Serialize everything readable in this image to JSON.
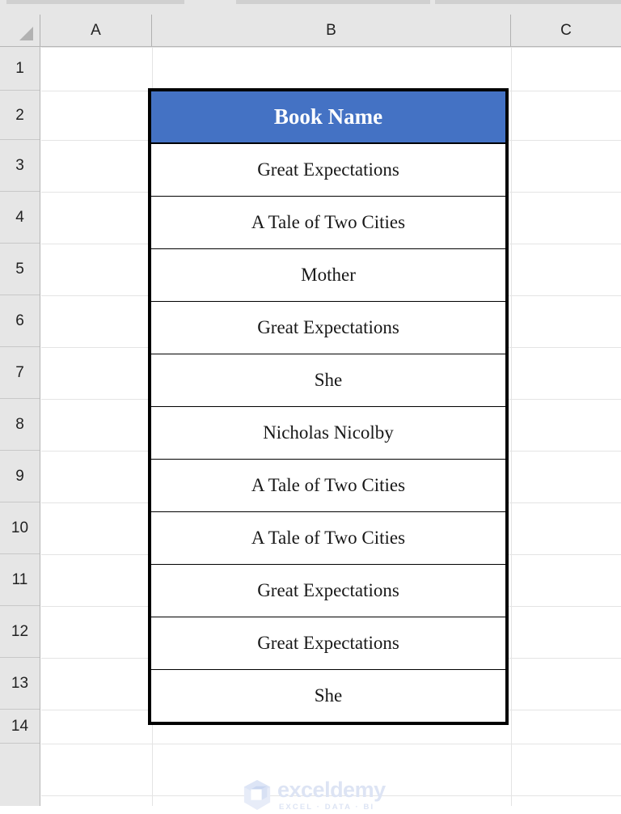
{
  "app": {
    "type": "spreadsheet",
    "ribbon_visible_fragment": true
  },
  "grid": {
    "select_all_icon": "select-all-triangle-icon",
    "columns": [
      {
        "id": "A",
        "label": "A"
      },
      {
        "id": "B",
        "label": "B"
      },
      {
        "id": "C",
        "label": "C"
      }
    ],
    "rows": [
      "1",
      "2",
      "3",
      "4",
      "5",
      "6",
      "7",
      "8",
      "9",
      "10",
      "11",
      "12",
      "13",
      "14"
    ]
  },
  "table": {
    "header": "Book Name",
    "header_bg_color": "#4472C4",
    "header_text_color": "#FFFFFF",
    "border_color": "#000000",
    "anchor_cell": "B2",
    "rows": [
      "Great Expectations",
      "A Tale of Two Cities",
      "Mother",
      "Great Expectations",
      "She",
      "Nicholas Nicolby",
      "A Tale of Two Cities",
      "A Tale of Two Cities",
      "Great Expectations",
      "Great Expectations",
      "She"
    ]
  },
  "watermark": {
    "title": "exceldemy",
    "tagline": "EXCEL · DATA · BI",
    "logo_icon": "exceldemy-cube-logo-icon",
    "color": "#DDE4F4"
  }
}
